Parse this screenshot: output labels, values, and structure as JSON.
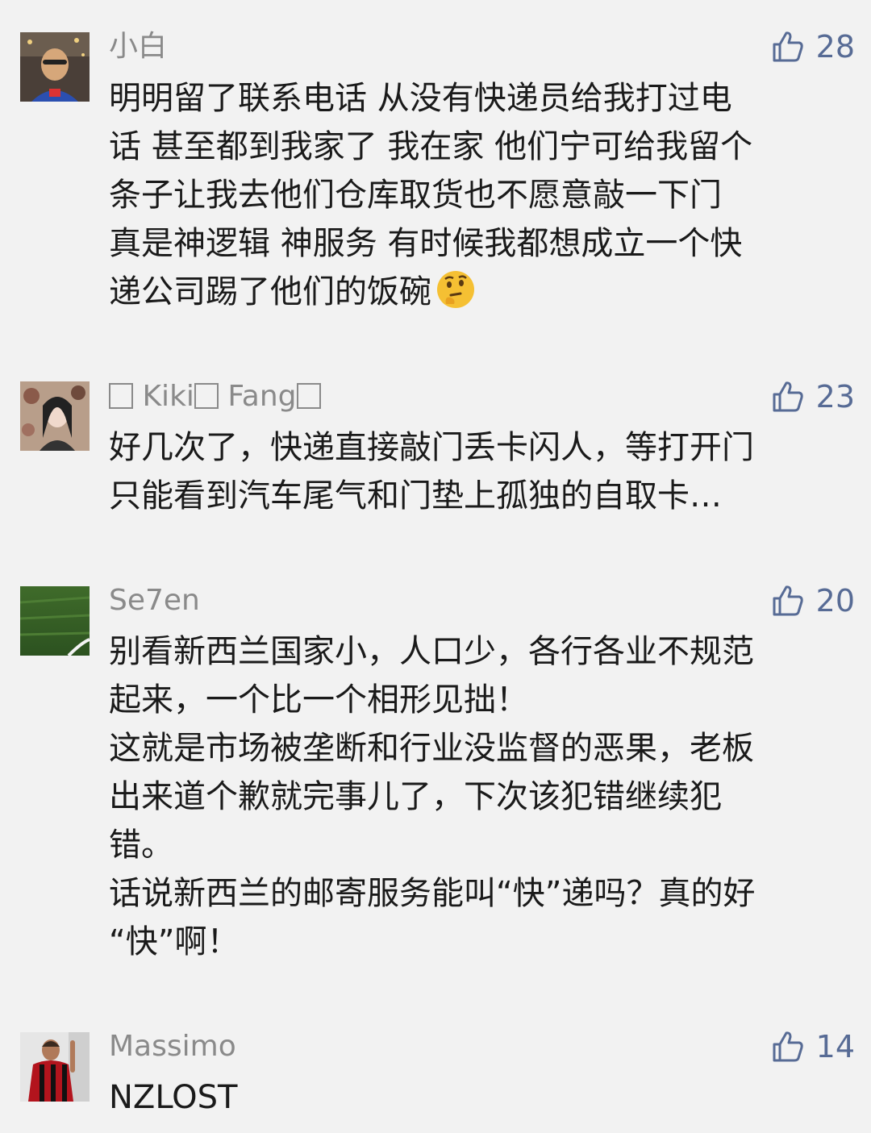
{
  "comments": [
    {
      "author": "小白",
      "likes": "28",
      "lines": [
        "明明留了联系电话 从没有快递员给我打过电",
        "话 甚至都到我家了 我在家 他们宁可给我留个",
        "条子让我去他们仓库取货也不愿意敲一下门",
        "真是神逻辑 神服务 有时候我都想成立一个快",
        "递公司踢了他们的饭碗"
      ],
      "trailing_emoji": "thinking-face-emoji"
    },
    {
      "author_parts": [
        "Kiki",
        "Fang"
      ],
      "likes": "23",
      "lines": [
        "好几次了，快递直接敲门丢卡闪人，等打开门",
        "只能看到汽车尾气和门垫上孤独的自取卡…"
      ]
    },
    {
      "author": "Se7en",
      "likes": "20",
      "lines": [
        "别看新西兰国家小，人口少，各行各业不规范",
        "起来，一个比一个相形见拙！",
        "这就是市场被垄断和行业没监督的恶果，老板",
        "出来道个歉就完事儿了，下次该犯错继续犯",
        "错。",
        "话说新西兰的邮寄服务能叫“快”递吗？真的好",
        "“快”啊！"
      ]
    },
    {
      "author": "Massimo",
      "likes": "14",
      "lines": [
        "NZLOST"
      ]
    }
  ],
  "colors": {
    "background": "#f2f2f2",
    "name": "#8a8a8a",
    "text": "#1a1a1a",
    "like": "#576b95"
  }
}
